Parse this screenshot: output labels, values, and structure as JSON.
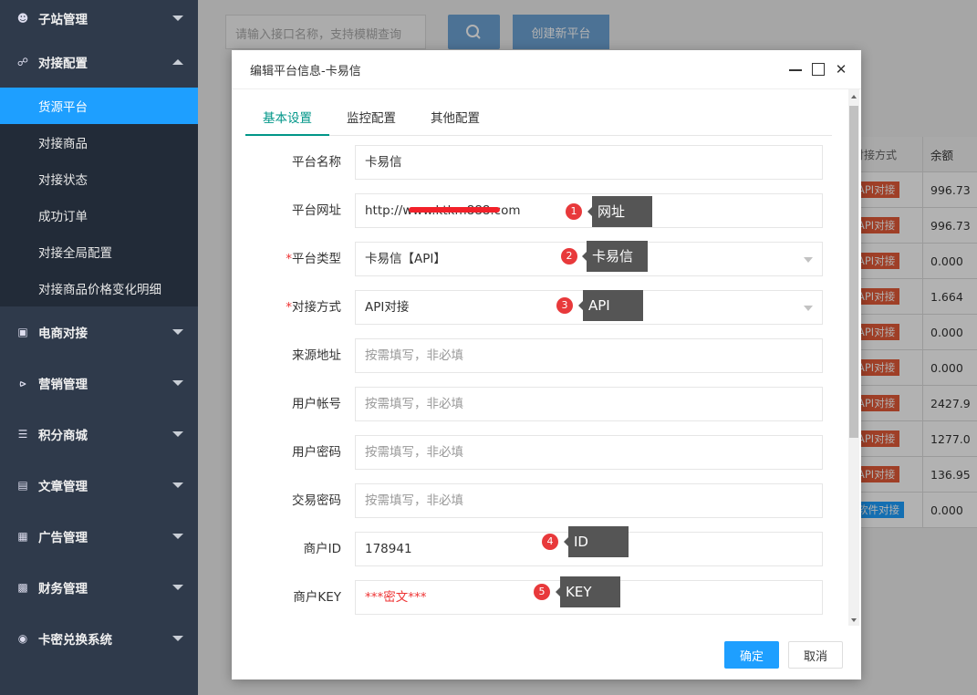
{
  "sidebar": {
    "groups_top": [
      {
        "label": "子站管理",
        "icon": "user-group-icon"
      },
      {
        "label": "对接配置",
        "icon": "link-icon"
      }
    ],
    "submenu": [
      {
        "label": "货源平台",
        "active": true
      },
      {
        "label": "对接商品"
      },
      {
        "label": "对接状态"
      },
      {
        "label": "成功订单"
      },
      {
        "label": "对接全局配置"
      },
      {
        "label": "对接商品价格变化明细"
      }
    ],
    "groups_bottom": [
      {
        "label": "电商对接",
        "icon": "lock-icon"
      },
      {
        "label": "营销管理",
        "icon": "share-icon"
      },
      {
        "label": "积分商城",
        "icon": "database-icon"
      },
      {
        "label": "文章管理",
        "icon": "document-icon"
      },
      {
        "label": "广告管理",
        "icon": "calendar-icon"
      },
      {
        "label": "财务管理",
        "icon": "finance-icon"
      },
      {
        "label": "卡密兑换系统",
        "icon": "exchange-icon"
      }
    ]
  },
  "toolbar": {
    "search_placeholder": "请输入接口名称，支持模糊查询",
    "create_label": "创建新平台"
  },
  "bg_table": {
    "headers": [
      "对接方式",
      "余额"
    ],
    "rows": [
      {
        "method": "API对接",
        "balance": "996.73"
      },
      {
        "method": "API对接",
        "balance": "996.73"
      },
      {
        "method": "API对接",
        "balance": "0.000"
      },
      {
        "method": "API对接",
        "balance": "1.664"
      },
      {
        "method": "API对接",
        "balance": "0.000"
      },
      {
        "method": "API对接",
        "balance": "0.000"
      },
      {
        "method": "API对接",
        "balance": "2427.9"
      },
      {
        "method": "API对接",
        "balance": "1277.0"
      },
      {
        "method": "API对接",
        "balance": "136.95"
      },
      {
        "method": "软件对接",
        "balance": "0.000"
      }
    ]
  },
  "modal": {
    "title": "编辑平台信息-卡易信",
    "tabs": [
      "基本设置",
      "监控配置",
      "其他配置"
    ],
    "fields": {
      "name": {
        "label": "平台名称",
        "value": "卡易信"
      },
      "url": {
        "label": "平台网址",
        "value": "http://www.ktkm888.com"
      },
      "type": {
        "label": "平台类型",
        "value": "卡易信【API】",
        "required_mark": "*"
      },
      "method": {
        "label": "对接方式",
        "value": "API对接",
        "required_mark": "*"
      },
      "source": {
        "label": "来源地址",
        "placeholder": "按需填写，非必填"
      },
      "user": {
        "label": "用户帐号",
        "placeholder": "按需填写，非必填"
      },
      "password": {
        "label": "用户密码",
        "placeholder": "按需填写，非必填"
      },
      "trade_password": {
        "label": "交易密码",
        "placeholder": "按需填写，非必填"
      },
      "merchant_id": {
        "label": "商户ID",
        "value": "178941"
      },
      "merchant_key": {
        "label": "商户KEY",
        "value": "***密文***"
      }
    },
    "ok_label": "确定",
    "cancel_label": "取消"
  },
  "annotations": [
    {
      "num": "1",
      "text": "网址"
    },
    {
      "num": "2",
      "text": "卡易信"
    },
    {
      "num": "3",
      "text": "API"
    },
    {
      "num": "4",
      "text": "ID"
    },
    {
      "num": "5",
      "text": "KEY"
    }
  ],
  "colors": {
    "sidebar_bg": "#2f3a4b",
    "active_blue": "#1e9fff",
    "tab_active": "#009688",
    "annotation_red": "#e8393b",
    "tag_orange": "#e45b38"
  }
}
